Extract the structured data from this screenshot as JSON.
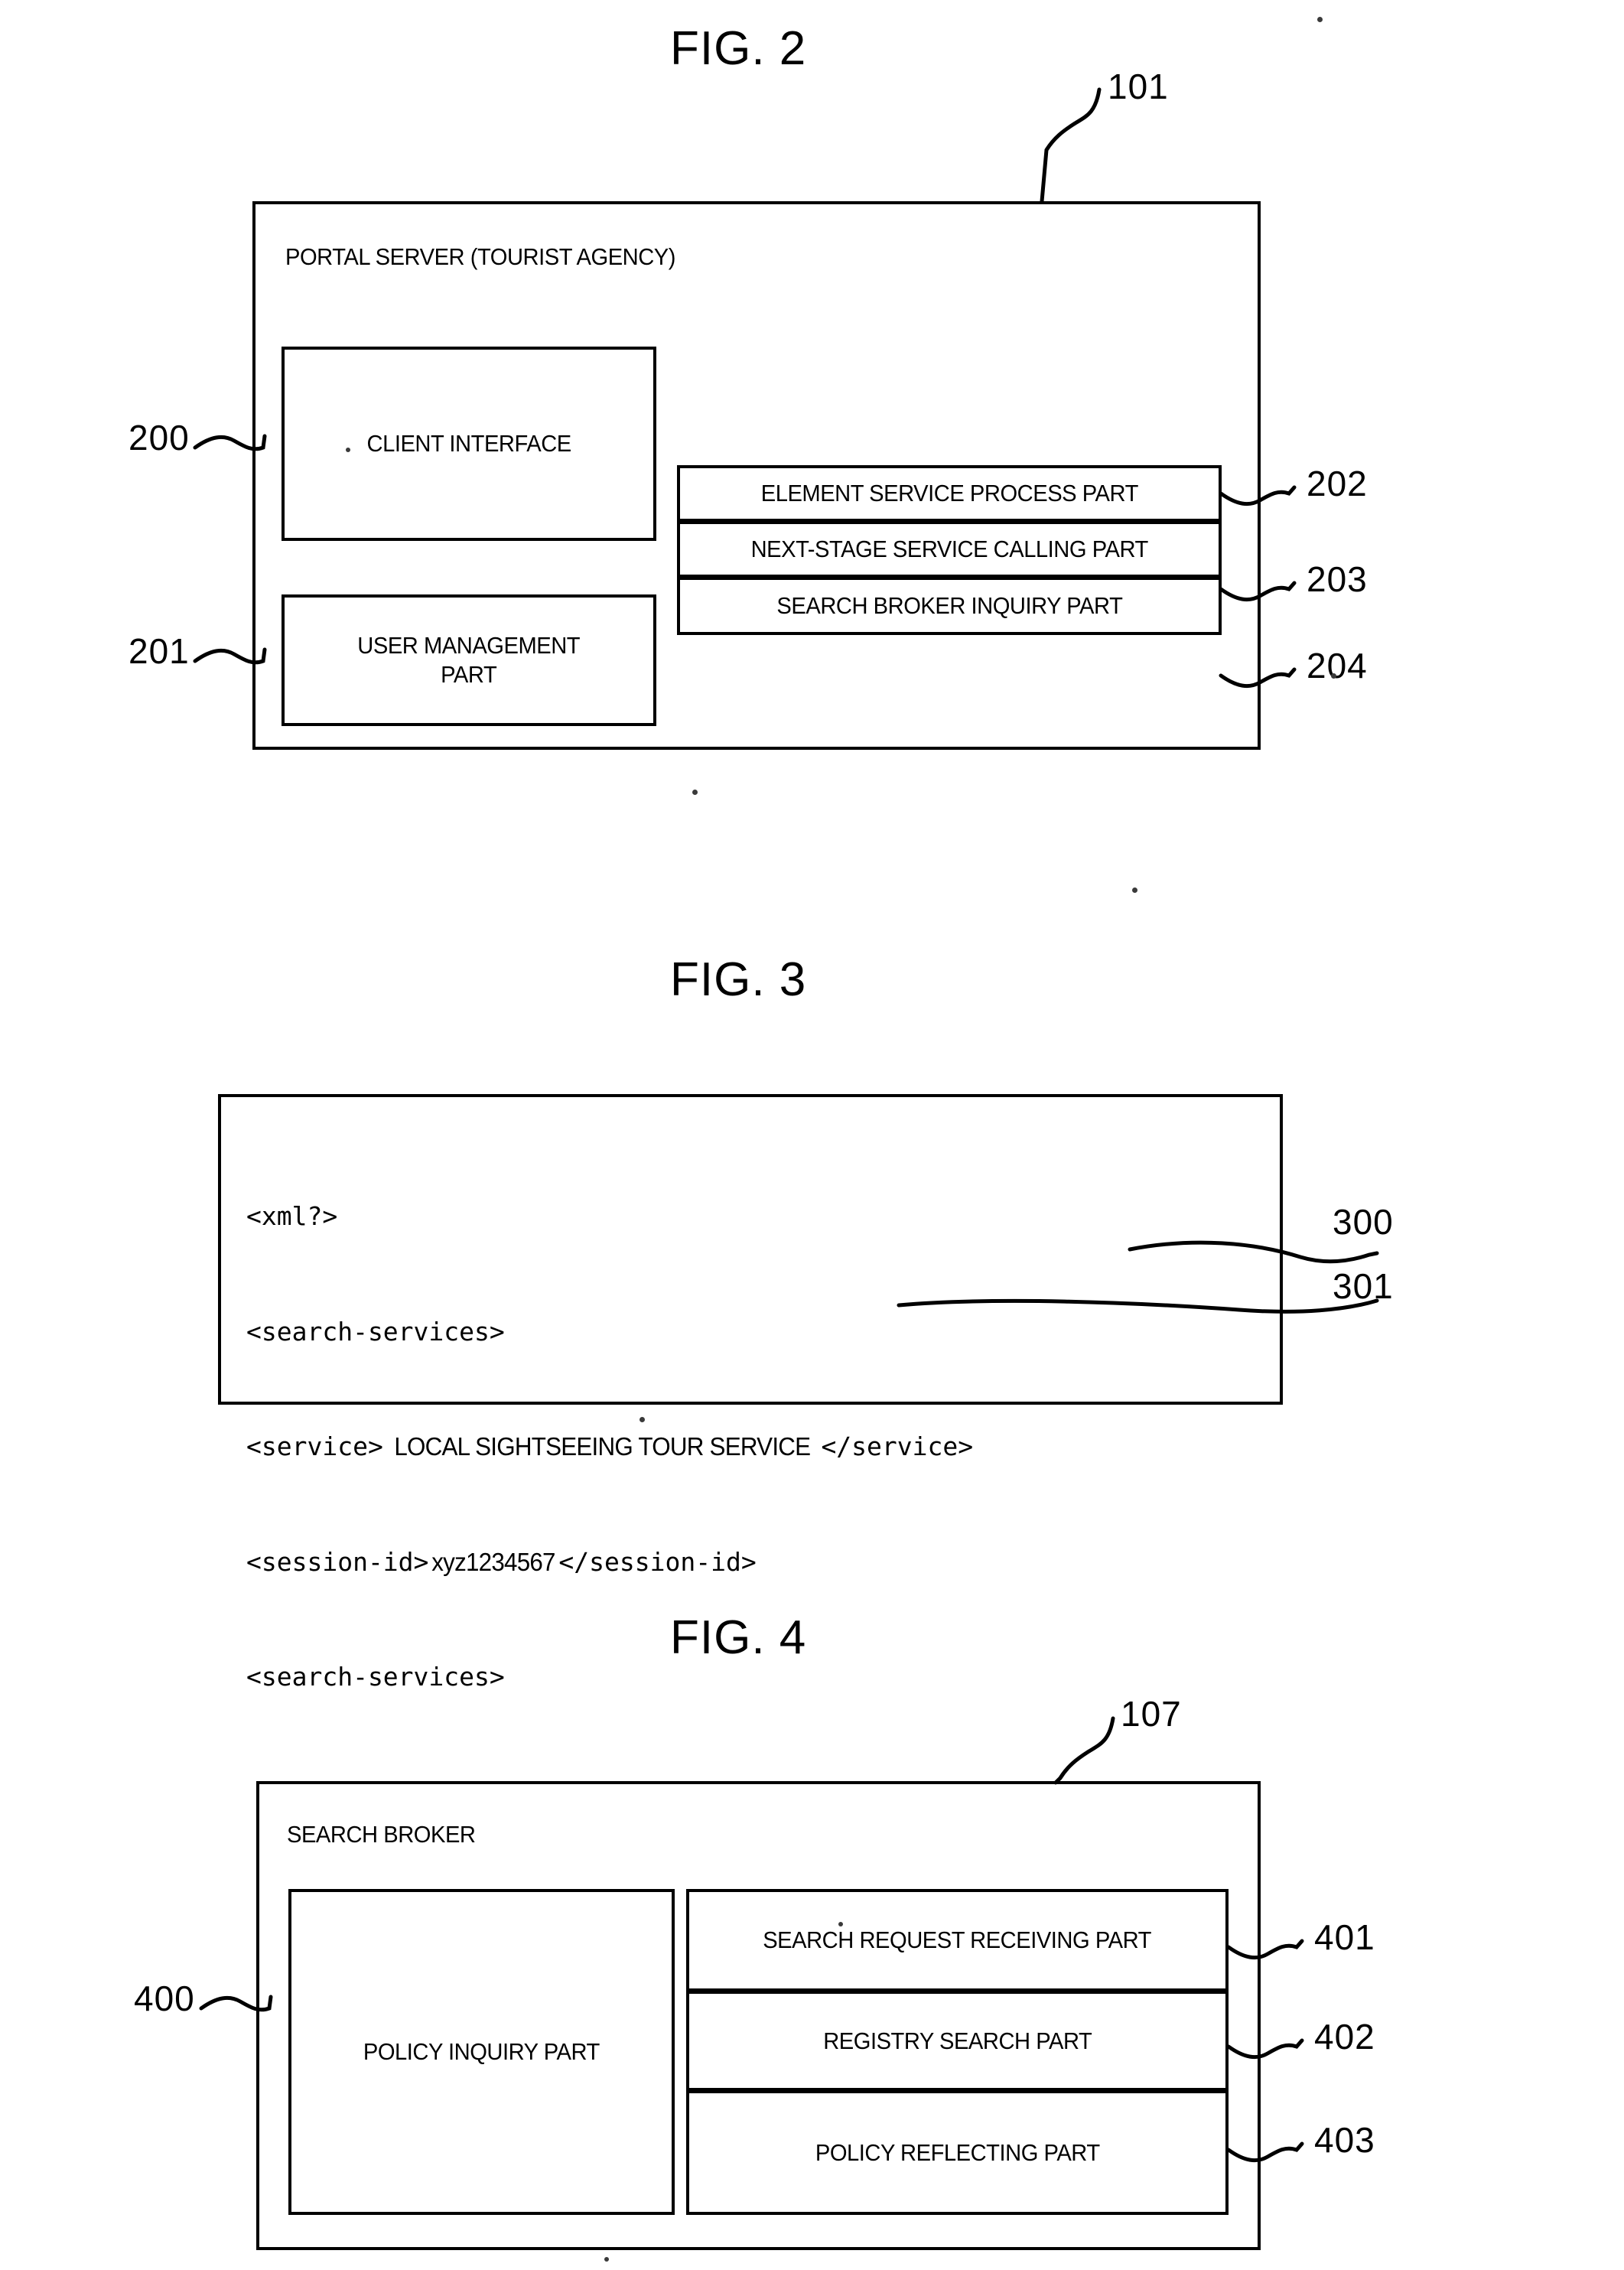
{
  "figures": [
    {
      "id": "fig2",
      "title": "FIG. 2",
      "outer_ref": "101",
      "outer_title": "PORTAL SERVER (TOURIST AGENCY)",
      "left_boxes": [
        {
          "label": "CLIENT INTERFACE",
          "ref": "200"
        },
        {
          "label": "USER MANAGEMENT\nPART",
          "ref": "201"
        }
      ],
      "right_boxes": [
        {
          "label": "ELEMENT SERVICE PROCESS PART",
          "ref": "202"
        },
        {
          "label": "NEXT-STAGE SERVICE CALLING PART",
          "ref": "203"
        },
        {
          "label": "SEARCH BROKER INQUIRY PART",
          "ref": "204"
        }
      ]
    },
    {
      "id": "fig3",
      "title": "FIG. 3",
      "code_lines": [
        {
          "text": "<xml?>",
          "style": "mono"
        },
        {
          "text": "<search-services>",
          "style": "mono"
        },
        {
          "text": "<service>",
          "mid": "LOCAL SIGHTSEEING TOUR SERVICE",
          "tail": "</service>",
          "style": "mixed",
          "ref": "300"
        },
        {
          "text": "<session-id>",
          "mid": "xyz1234567",
          "tail": "</session-id>",
          "style": "mixed",
          "ref": "301"
        },
        {
          "text": "<search-services>",
          "style": "mono"
        }
      ],
      "refs": [
        "300",
        "301"
      ]
    },
    {
      "id": "fig4",
      "title": "FIG. 4",
      "outer_ref": "107",
      "outer_title": "SEARCH BROKER",
      "left_boxes": [
        {
          "label": "POLICY INQUIRY PART",
          "ref": "400"
        }
      ],
      "right_boxes": [
        {
          "label": "SEARCH REQUEST RECEIVING PART",
          "ref": "401"
        },
        {
          "label": "REGISTRY SEARCH PART",
          "ref": "402"
        },
        {
          "label": "POLICY REFLECTING PART",
          "ref": "403"
        }
      ]
    }
  ],
  "colors": {
    "ink": "#000000",
    "paper": "#ffffff"
  }
}
